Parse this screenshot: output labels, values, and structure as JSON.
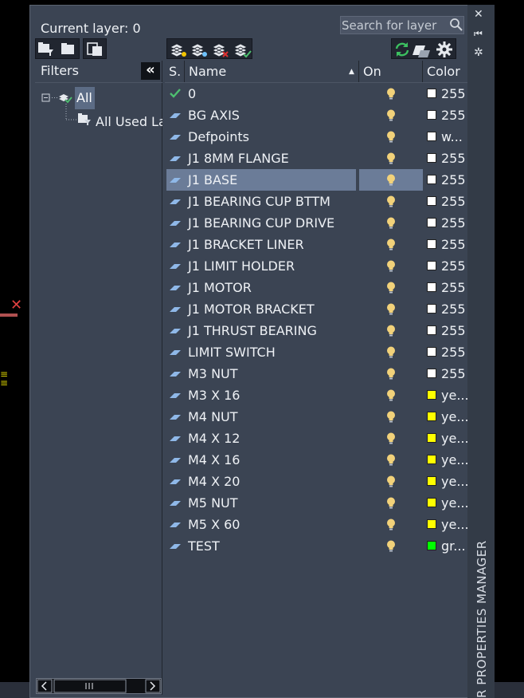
{
  "palette": {
    "current_layer": "Current layer: 0",
    "vertical_title": "R PROPERTIES MANAGER",
    "search_placeholder": "Search for layer"
  },
  "filters": {
    "header": "Filters",
    "tree": [
      {
        "label": "All",
        "selected": true
      },
      {
        "label": "All Used Layers"
      }
    ]
  },
  "table": {
    "columns": [
      "S.",
      "Name",
      "On",
      "Color"
    ],
    "rows": [
      {
        "name": "0",
        "current": true,
        "color_name": "255",
        "swatch": "#ffffff"
      },
      {
        "name": "BG AXIS",
        "color_name": "255",
        "swatch": "#ffffff"
      },
      {
        "name": "Defpoints",
        "color_name": "w...",
        "swatch": "#ffffff"
      },
      {
        "name": "J1 8MM FLANGE",
        "color_name": "255",
        "swatch": "#ffffff"
      },
      {
        "name": "J1 BASE",
        "selected": true,
        "color_name": "255",
        "swatch": "#ffffff"
      },
      {
        "name": "J1 BEARING CUP BTTM",
        "color_name": "255",
        "swatch": "#ffffff"
      },
      {
        "name": "J1 BEARING CUP DRIVE",
        "color_name": "255",
        "swatch": "#ffffff"
      },
      {
        "name": "J1 BRACKET LINER",
        "color_name": "255",
        "swatch": "#ffffff"
      },
      {
        "name": "J1 LIMIT HOLDER",
        "color_name": "255",
        "swatch": "#ffffff"
      },
      {
        "name": "J1 MOTOR",
        "color_name": "255",
        "swatch": "#ffffff"
      },
      {
        "name": "J1 MOTOR BRACKET",
        "color_name": "255",
        "swatch": "#ffffff"
      },
      {
        "name": "J1 THRUST BEARING",
        "color_name": "255",
        "swatch": "#ffffff"
      },
      {
        "name": "LIMIT SWITCH",
        "color_name": "255",
        "swatch": "#ffffff"
      },
      {
        "name": "M3 NUT",
        "color_name": "255",
        "swatch": "#ffffff"
      },
      {
        "name": "M3 X 16",
        "color_name": "ye...",
        "swatch": "#ffff00"
      },
      {
        "name": "M4 NUT",
        "color_name": "ye...",
        "swatch": "#ffff00"
      },
      {
        "name": "M4 X 12",
        "color_name": "ye...",
        "swatch": "#ffff00"
      },
      {
        "name": "M4 X 16",
        "color_name": "ye...",
        "swatch": "#ffff00"
      },
      {
        "name": "M4 X 20",
        "color_name": "ye...",
        "swatch": "#ffff00"
      },
      {
        "name": "M5 NUT",
        "color_name": "ye...",
        "swatch": "#ffff00"
      },
      {
        "name": "M5 X 60",
        "color_name": "ye...",
        "swatch": "#ffff00"
      },
      {
        "name": "TEST",
        "color_name": "gr...",
        "swatch": "#00ff00"
      }
    ]
  },
  "colors": {
    "panel": "#3b4453",
    "selection": "#6b7c98",
    "bulb": "#f2d27a",
    "check": "#4ec070",
    "layer_icon": "#8fb8e8"
  }
}
